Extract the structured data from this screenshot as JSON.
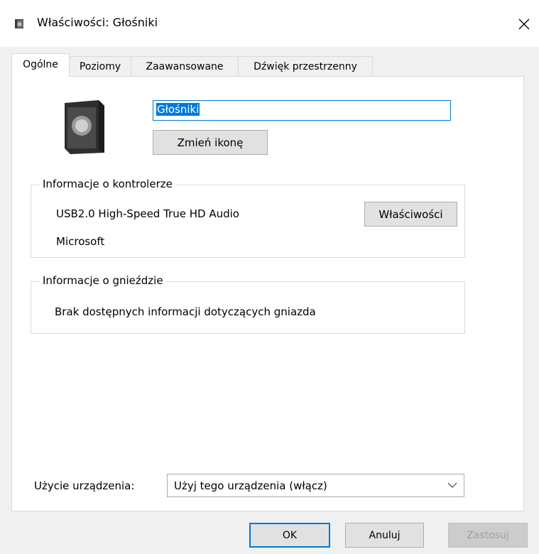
{
  "window": {
    "title": "Właściwości: Głośniki"
  },
  "tabs": [
    {
      "label": "Ogólne",
      "active": true
    },
    {
      "label": "Poziomy",
      "active": false
    },
    {
      "label": "Zaawansowane",
      "active": false
    },
    {
      "label": "Dźwięk przestrzenny",
      "active": false
    }
  ],
  "general": {
    "device_name": "Głośniki",
    "change_icon_label": "Zmień ikonę",
    "controller_group": {
      "legend": "Informacje o kontrolerze",
      "controller_name": "USB2.0 High-Speed True HD Audio",
      "manufacturer": "Microsoft",
      "properties_label": "Właściwości"
    },
    "jack_group": {
      "legend": "Informacje o gnieździe",
      "info": "Brak dostępnych informacji dotyczących gniazda"
    },
    "device_usage": {
      "label": "Użycie urządzenia:",
      "selected": "Użyj tego urządzenia (włącz)"
    }
  },
  "footer": {
    "ok": "OK",
    "cancel": "Anuluj",
    "apply": "Zastosuj"
  },
  "colors": {
    "accent": "#0078d7",
    "disabled_text": "#a0a0a0",
    "button_face": "#e1e1e1"
  }
}
